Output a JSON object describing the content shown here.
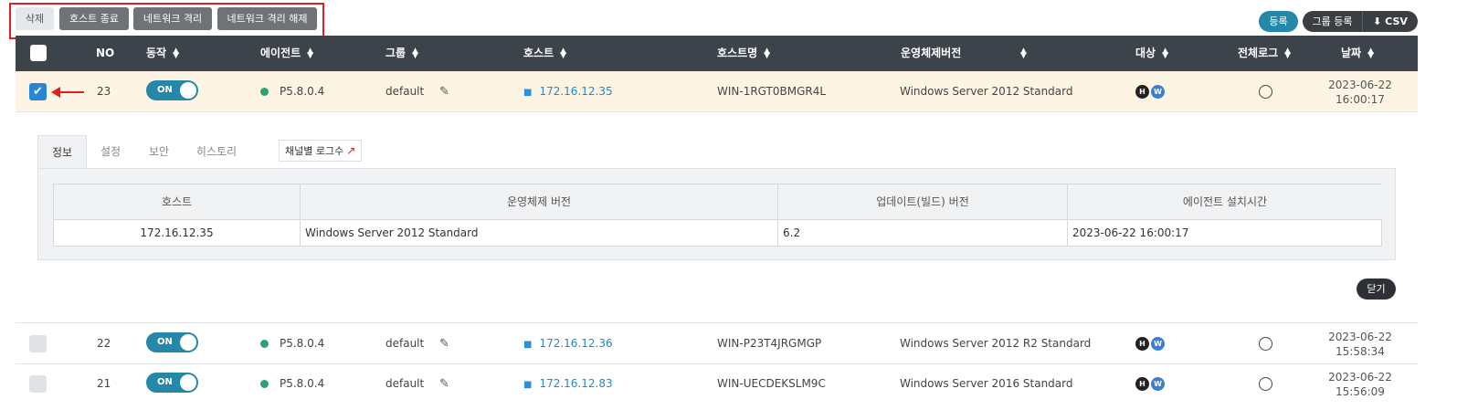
{
  "toolbar": {
    "delete": "삭제",
    "terminate_host": "호스트 종료",
    "isolate_network": "네트워크 격리",
    "release_isolation": "네트워크 격리 해제"
  },
  "actions": {
    "register": "등록",
    "group_register": "그룹 등록",
    "csv": "CSV"
  },
  "columns": {
    "no": "NO",
    "action": "동작",
    "agent": "에이전트",
    "group": "그룹",
    "host": "호스트",
    "hostname": "호스트명",
    "os_version": "운영체제버전",
    "target": "대상",
    "all_log": "전체로그",
    "date": "날짜"
  },
  "rows": [
    {
      "no": "23",
      "toggle": "ON",
      "agent": "P5.8.0.4",
      "group": "default",
      "host": "172.16.12.35",
      "hostname": "WIN-1RGT0BMGR4L",
      "os": "Windows Server 2012 Standard",
      "badge_h": "H",
      "badge_w": "W",
      "date": "2023-06-22",
      "time": "16:00:17",
      "checked": true
    },
    {
      "no": "22",
      "toggle": "ON",
      "agent": "P5.8.0.4",
      "group": "default",
      "host": "172.16.12.36",
      "hostname": "WIN-P23T4JRGMGP",
      "os": "Windows Server 2012 R2 Standard",
      "badge_h": "H",
      "badge_w": "W",
      "date": "2023-06-22",
      "time": "15:58:34",
      "checked": false
    },
    {
      "no": "21",
      "toggle": "ON",
      "agent": "P5.8.0.4",
      "group": "default",
      "host": "172.16.12.83",
      "hostname": "WIN-UECDEKSLM9C",
      "os": "Windows Server 2016 Standard",
      "badge_h": "H",
      "badge_w": "W",
      "date": "2023-06-22",
      "time": "15:56:09",
      "checked": false
    }
  ],
  "detail": {
    "tabs": [
      "정보",
      "설정",
      "보안",
      "히스토리"
    ],
    "channel_log": "채널별 로그수",
    "headers": [
      "호스트",
      "운영체제 버전",
      "업데이트(빌드) 버전",
      "에이전트 설치시간"
    ],
    "values": [
      "172.16.12.35",
      "Windows Server 2012 Standard",
      "6.2",
      "2023-06-22 16:00:17"
    ],
    "close": "닫기"
  },
  "colors": {
    "accent": "#2688a8",
    "header_bg": "#3d434a",
    "highlight_border": "#e0201f",
    "selected_row": "#fdf4e4"
  }
}
